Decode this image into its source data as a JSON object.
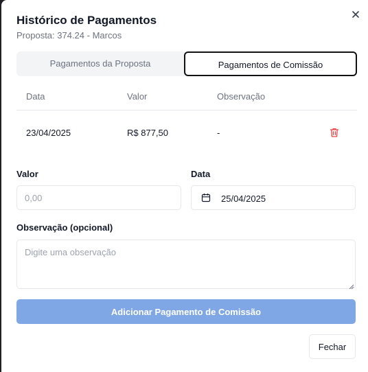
{
  "dialog": {
    "title": "Histórico de Pagamentos",
    "subtitle": "Proposta: 374.24 - Marcos",
    "close_icon": "close-icon"
  },
  "tabs": [
    {
      "label": "Pagamentos da Proposta",
      "active": false
    },
    {
      "label": "Pagamentos de Comissão",
      "active": true
    }
  ],
  "table": {
    "headers": [
      "Data",
      "Valor",
      "Observação"
    ],
    "rows": [
      {
        "data": "23/04/2025",
        "valor": "R$ 877,50",
        "observacao": "-",
        "action_icon": "trash-icon"
      }
    ]
  },
  "form": {
    "valor_label": "Valor",
    "valor_placeholder": "0,00",
    "data_label": "Data",
    "data_value": "25/04/2025",
    "data_icon": "calendar-icon",
    "obs_label": "Observação (opcional)",
    "obs_placeholder": "Digite uma observação",
    "submit_label": "Adicionar Pagamento de Comissão"
  },
  "footer": {
    "close_label": "Fechar"
  },
  "colors": {
    "primary_button": "#7fa7e6",
    "danger_icon": "#ef4444",
    "muted_text": "#6b7280"
  }
}
